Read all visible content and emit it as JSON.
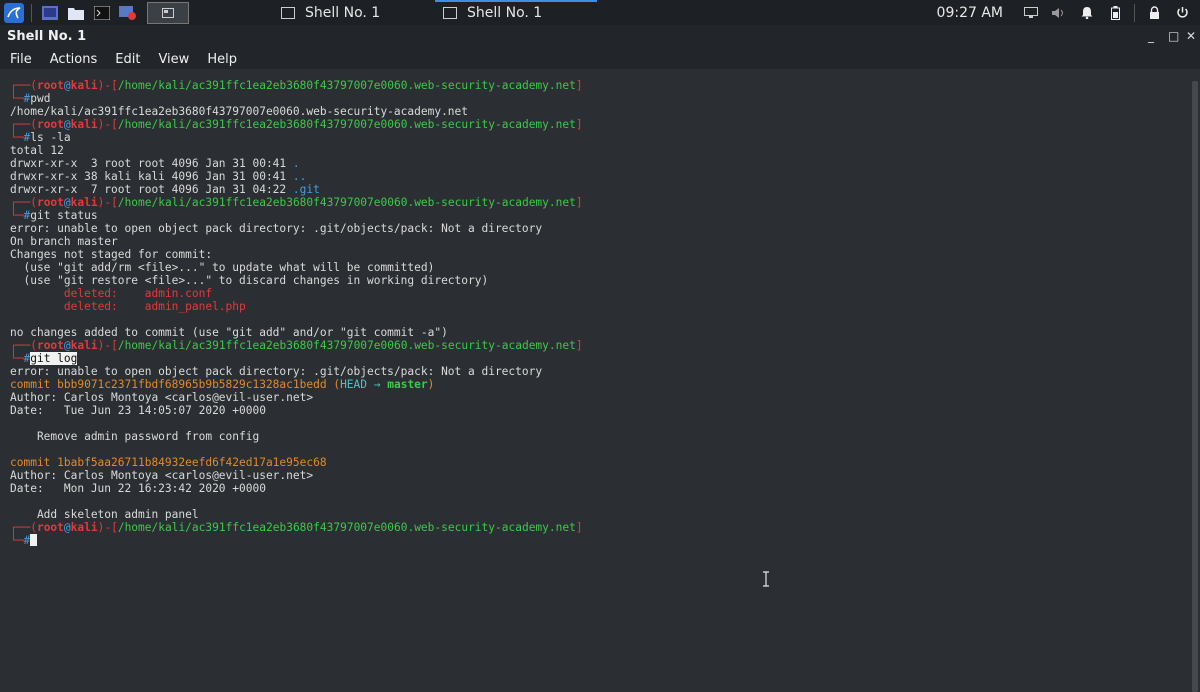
{
  "taskbar": {
    "tasks": [
      {
        "label": "Shell No. 1"
      },
      {
        "label": "Shell No. 1"
      }
    ],
    "clock": "09:27 AM"
  },
  "window": {
    "title": "Shell No. 1",
    "controls": {
      "minimize": "_",
      "maximize": "□",
      "close": "✕"
    }
  },
  "menu": [
    "File",
    "Actions",
    "Edit",
    "View",
    "Help"
  ],
  "prompt": {
    "user": "root",
    "at": "@",
    "host": "kali",
    "path": "/home/kali/ac391ffc1ea2eb3680f43797007e0060.web-security-academy.net",
    "symbol": "#"
  },
  "terminal": {
    "cmd_pwd": "pwd",
    "pwd_out": "/home/kali/ac391ffc1ea2eb3680f43797007e0060.web-security-academy.net",
    "cmd_ls": "ls -la",
    "ls_total": "total 12",
    "ls_rows": [
      {
        "text": "drwxr-xr-x  3 root root 4096 Jan 31 00:41 ",
        "name": "."
      },
      {
        "text": "drwxr-xr-x 38 kali kali 4096 Jan 31 00:41 ",
        "name": ".."
      },
      {
        "text": "drwxr-xr-x  7 root root 4096 Jan 31 04:22 ",
        "name": ".git"
      }
    ],
    "cmd_status": "git status",
    "err": "error: unable to open object pack directory: .git/objects/pack: Not a directory",
    "branch": "On branch master",
    "changes": "Changes not staged for commit:",
    "hint1": "  (use \"git add/rm <file>...\" to update what will be committed)",
    "hint2": "  (use \"git restore <file>...\" to discard changes in working directory)",
    "deleted_label": "deleted:",
    "deleted_files": [
      "admin.conf",
      "admin_panel.php"
    ],
    "nochanges": "no changes added to commit (use \"git add\" and/or \"git commit -a\")",
    "cmd_log": "git log",
    "commits": [
      {
        "hash": "commit bbb9071c2371fbdf68965b9b5829c1328ac1bedd",
        "refs_open": " (",
        "head": "HEAD",
        "arrow": " → ",
        "branch": "master",
        "refs_close": ")",
        "author": "Author: Carlos Montoya <carlos@evil-user.net>",
        "date": "Date:   Tue Jun 23 14:05:07 2020 +0000",
        "message": "    Remove admin password from config"
      },
      {
        "hash": "commit 1babf5aa26711b84932eefd6f42ed17a1e95ec68",
        "author": "Author: Carlos Montoya <carlos@evil-user.net>",
        "date": "Date:   Mon Jun 22 16:23:42 2020 +0000",
        "message": "    Add skeleton admin panel"
      }
    ]
  },
  "colors": {
    "accent": "#3d8ee8",
    "terminal_bg": "#2b2f33",
    "prompt_red": "#e03a3a",
    "path_green": "#3ec74a"
  }
}
